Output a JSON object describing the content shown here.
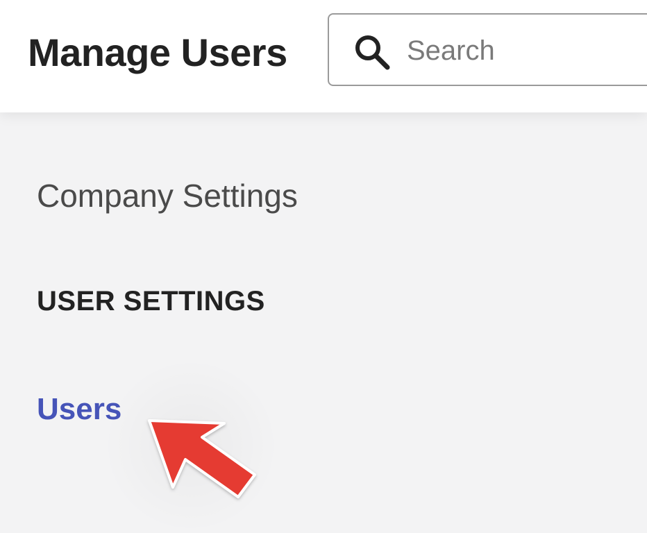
{
  "header": {
    "title": "Manage Users",
    "search": {
      "placeholder": "Search",
      "value": ""
    }
  },
  "sidebar": {
    "company_settings_label": "Company Settings",
    "section_heading": "USER SETTINGS",
    "items": [
      {
        "label": "Users",
        "active": true
      }
    ]
  },
  "icons": {
    "search": "search-icon",
    "pointer": "red-arrow-icon"
  },
  "colors": {
    "accent": "#4654b8",
    "arrow": "#e53b30",
    "text_dark": "#222222",
    "background": "#f3f3f4"
  }
}
